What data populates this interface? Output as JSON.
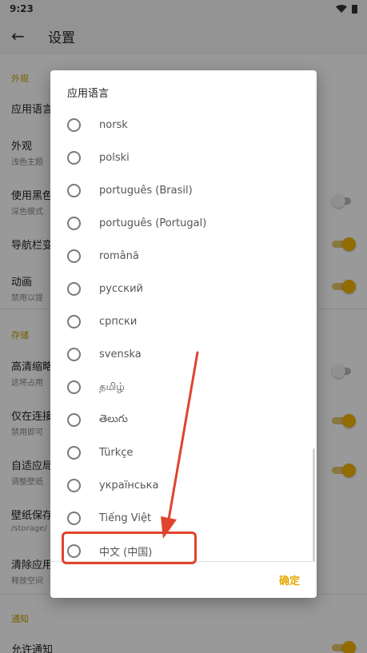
{
  "status_bar": {
    "time": "9:23",
    "wifi_icon": "wifi-icon",
    "battery_icon": "battery-icon"
  },
  "app_bar": {
    "back_icon": "arrow-left-icon",
    "title": "设置"
  },
  "settings": {
    "appearance_header": "外观",
    "app_language": "应用语言",
    "appearance": {
      "title": "外观",
      "sub": "浅色主题"
    },
    "black_theme": {
      "title": "使用黑色",
      "sub": "深色模式",
      "on": false
    },
    "nav_bar": {
      "title": "导航栏变",
      "on": true
    },
    "animation": {
      "title": "动画",
      "sub": "禁用以提",
      "on": true
    },
    "storage_header": "存储",
    "hd_thumb": {
      "title": "高清缩略",
      "sub": "这将占用",
      "on": false
    },
    "wifi_only": {
      "title": "仅在连接",
      "sub": "禁用即可",
      "on": true
    },
    "adaptive": {
      "title": "自适应局",
      "sub": "调整壁纸",
      "on": true
    },
    "save_path": {
      "title": "壁纸保存",
      "sub": "/storage/"
    },
    "clear_cache": {
      "title": "清除应用",
      "sub": "释放空间"
    },
    "notify_header": "通知",
    "allow_notify": {
      "title": "允许通知",
      "on": true
    }
  },
  "dialog": {
    "title": "应用语言",
    "languages": [
      "norsk",
      "polski",
      "português (Brasil)",
      "português (Portugal)",
      "română",
      "русский",
      "српски",
      "svenska",
      "தமிழ்",
      "తెలుగు",
      "Türkçe",
      "українська",
      "Tiếng Việt",
      "中文 (中国)"
    ],
    "confirm_label": "确定"
  },
  "annotation": {
    "highlighted_item": "中文 (中国)",
    "color": "#e0442c"
  },
  "colors": {
    "accent": "#f4b400",
    "annotation_red": "#e0442c"
  }
}
